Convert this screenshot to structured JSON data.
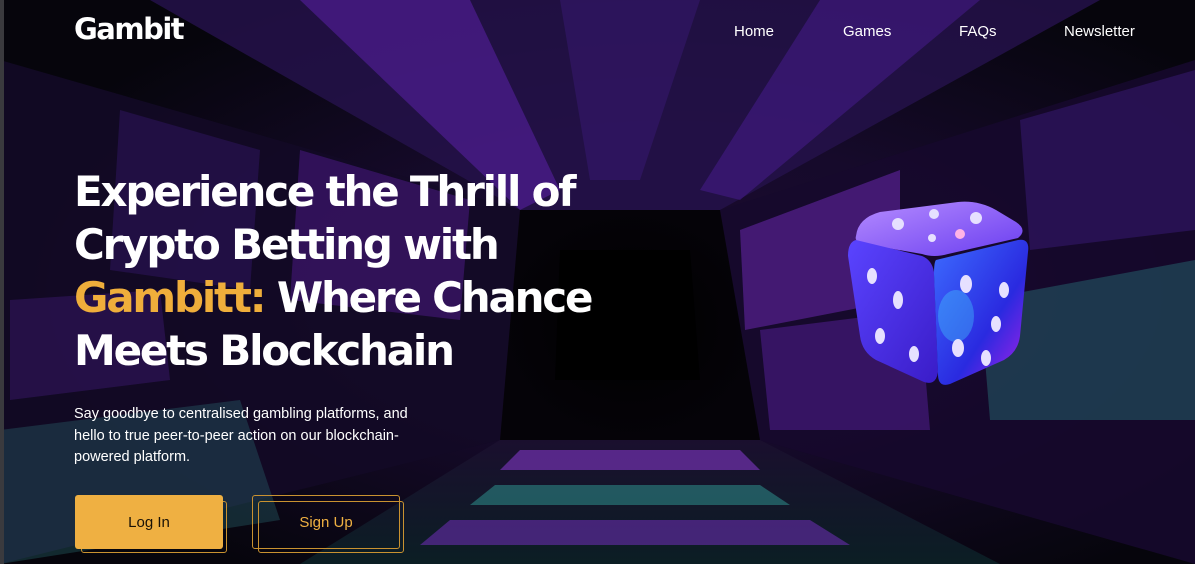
{
  "brand": {
    "logo": "Gambit"
  },
  "nav": {
    "items": [
      {
        "label": "Home"
      },
      {
        "label": "Games"
      },
      {
        "label": "FAQs"
      },
      {
        "label": "Newsletter"
      }
    ]
  },
  "hero": {
    "title_line1": "Experience the Thrill of",
    "title_line2": "Crypto Betting with",
    "title_accent": "Gambitt:",
    "title_line3_rest": " Where Chance",
    "title_line4": "Meets Blockchain",
    "subtitle": "Say goodbye to centralised gambling platforms, and hello to true peer-to-peer action on our blockchain-powered platform."
  },
  "actions": {
    "login_label": "Log In",
    "signup_label": "Sign Up"
  },
  "theme": {
    "accent": "#efae3b",
    "background": "#07060d",
    "text": "#ffffff",
    "tunnel_purple": "#7a2fc8",
    "tunnel_teal": "#2e8f8c"
  },
  "icons": {
    "hero_graphic": "dice-icon",
    "background": "tunnel-background"
  }
}
